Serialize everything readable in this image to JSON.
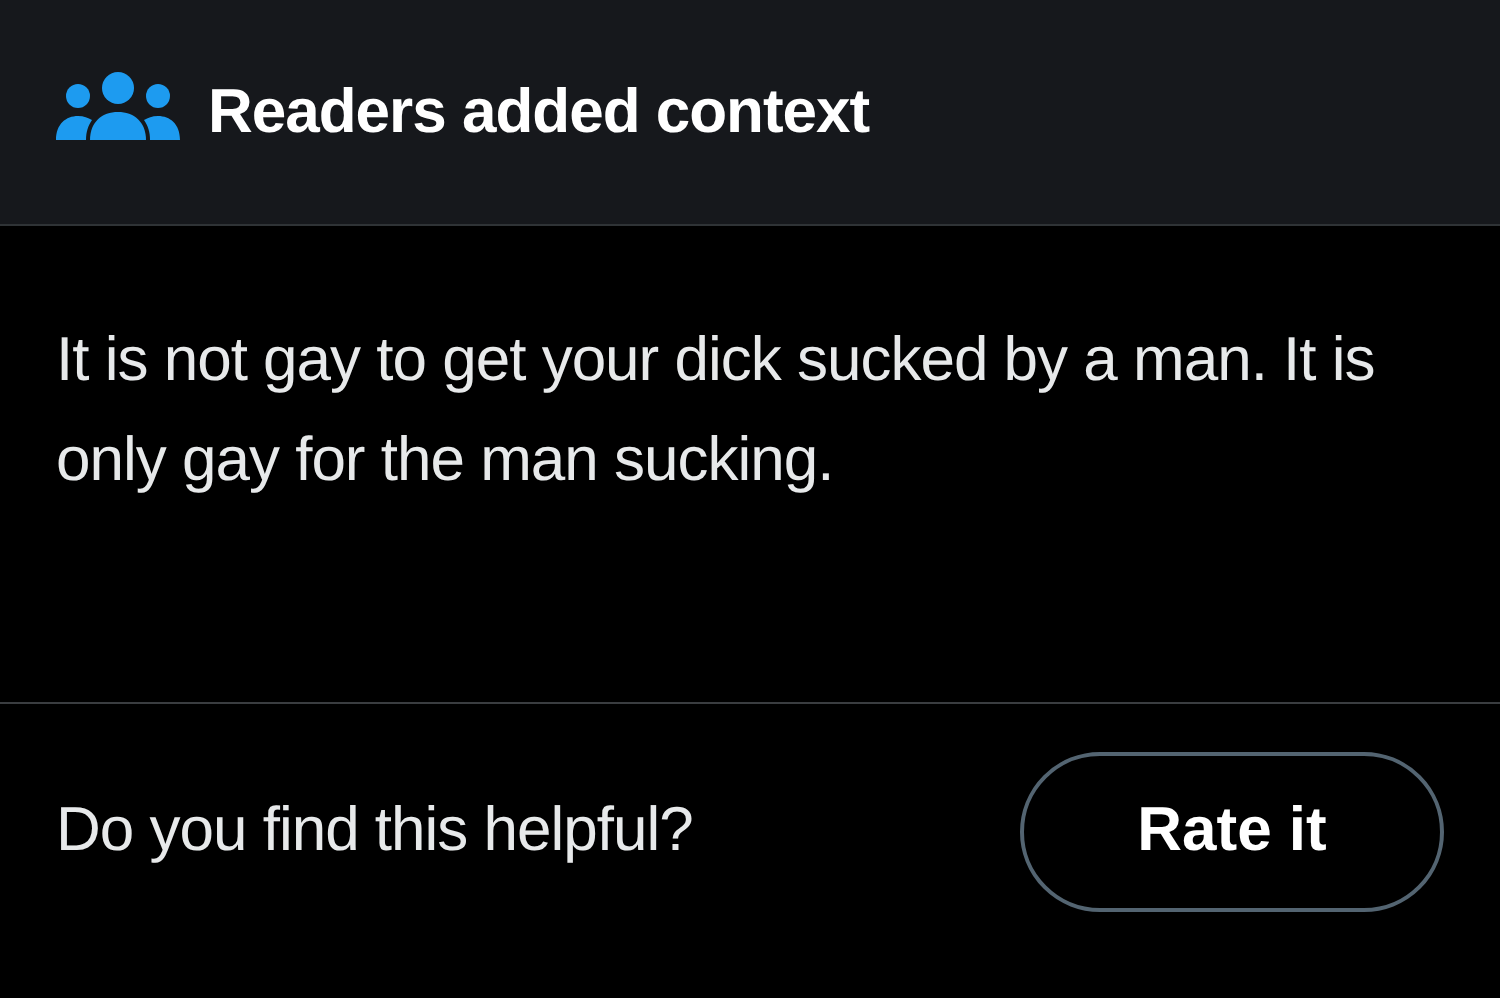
{
  "header": {
    "title": "Readers added context"
  },
  "note": {
    "text": "It is not gay to get your dick sucked by a man. It is only gay for the man sucking."
  },
  "footer": {
    "question": "Do you find this helpful?",
    "button": "Rate it"
  }
}
